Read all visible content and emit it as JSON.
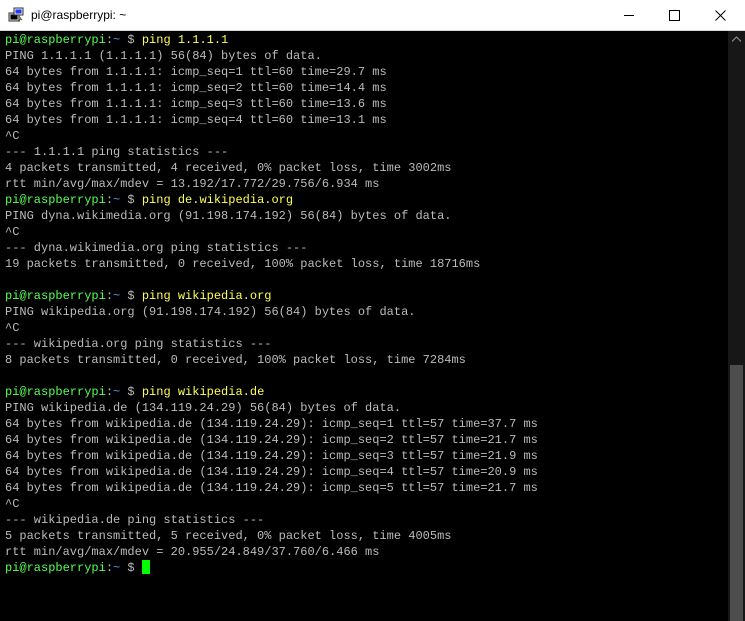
{
  "window": {
    "title": "pi@raspberrypi: ~",
    "icon": "putty-terminal-icon",
    "controls": [
      "minimize-icon",
      "maximize-icon",
      "close-icon"
    ]
  },
  "prompt": {
    "user_host": "pi@raspberrypi",
    "separator": ":",
    "path": "~",
    "symbol": " $ "
  },
  "colors": {
    "background": "#000000",
    "text": "#bbbbbb",
    "prompt_user": "#55ff55",
    "prompt_path": "#5c8cff",
    "command": "#ffff55",
    "cursor": "#00ff00"
  },
  "lines": [
    {
      "type": "prompt",
      "cmd": "ping 1.1.1.1"
    },
    {
      "type": "out",
      "text": "PING 1.1.1.1 (1.1.1.1) 56(84) bytes of data."
    },
    {
      "type": "out",
      "text": "64 bytes from 1.1.1.1: icmp_seq=1 ttl=60 time=29.7 ms"
    },
    {
      "type": "out",
      "text": "64 bytes from 1.1.1.1: icmp_seq=2 ttl=60 time=14.4 ms"
    },
    {
      "type": "out",
      "text": "64 bytes from 1.1.1.1: icmp_seq=3 ttl=60 time=13.6 ms"
    },
    {
      "type": "out",
      "text": "64 bytes from 1.1.1.1: icmp_seq=4 ttl=60 time=13.1 ms"
    },
    {
      "type": "out",
      "text": "^C"
    },
    {
      "type": "out",
      "text": "--- 1.1.1.1 ping statistics ---"
    },
    {
      "type": "out",
      "text": "4 packets transmitted, 4 received, 0% packet loss, time 3002ms"
    },
    {
      "type": "out",
      "text": "rtt min/avg/max/mdev = 13.192/17.772/29.756/6.934 ms"
    },
    {
      "type": "prompt",
      "cmd": "ping de.wikipedia.org"
    },
    {
      "type": "out",
      "text": "PING dyna.wikimedia.org (91.198.174.192) 56(84) bytes of data."
    },
    {
      "type": "out",
      "text": "^C"
    },
    {
      "type": "out",
      "text": "--- dyna.wikimedia.org ping statistics ---"
    },
    {
      "type": "out",
      "text": "19 packets transmitted, 0 received, 100% packet loss, time 18716ms"
    },
    {
      "type": "out",
      "text": ""
    },
    {
      "type": "prompt",
      "cmd": "ping wikipedia.org"
    },
    {
      "type": "out",
      "text": "PING wikipedia.org (91.198.174.192) 56(84) bytes of data."
    },
    {
      "type": "out",
      "text": "^C"
    },
    {
      "type": "out",
      "text": "--- wikipedia.org ping statistics ---"
    },
    {
      "type": "out",
      "text": "8 packets transmitted, 0 received, 100% packet loss, time 7284ms"
    },
    {
      "type": "out",
      "text": ""
    },
    {
      "type": "prompt",
      "cmd": "ping wikipedia.de"
    },
    {
      "type": "out",
      "text": "PING wikipedia.de (134.119.24.29) 56(84) bytes of data."
    },
    {
      "type": "out",
      "text": "64 bytes from wikipedia.de (134.119.24.29): icmp_seq=1 ttl=57 time=37.7 ms"
    },
    {
      "type": "out",
      "text": "64 bytes from wikipedia.de (134.119.24.29): icmp_seq=2 ttl=57 time=21.7 ms"
    },
    {
      "type": "out",
      "text": "64 bytes from wikipedia.de (134.119.24.29): icmp_seq=3 ttl=57 time=21.9 ms"
    },
    {
      "type": "out",
      "text": "64 bytes from wikipedia.de (134.119.24.29): icmp_seq=4 ttl=57 time=20.9 ms"
    },
    {
      "type": "out",
      "text": "64 bytes from wikipedia.de (134.119.24.29): icmp_seq=5 ttl=57 time=21.7 ms"
    },
    {
      "type": "out",
      "text": "^C"
    },
    {
      "type": "out",
      "text": "--- wikipedia.de ping statistics ---"
    },
    {
      "type": "out",
      "text": "5 packets transmitted, 5 received, 0% packet loss, time 4005ms"
    },
    {
      "type": "out",
      "text": "rtt min/avg/max/mdev = 20.955/24.849/37.760/6.466 ms"
    },
    {
      "type": "prompt",
      "cmd": "",
      "cursor": true
    }
  ],
  "scrollbar": {
    "position_fraction": 0.57
  }
}
